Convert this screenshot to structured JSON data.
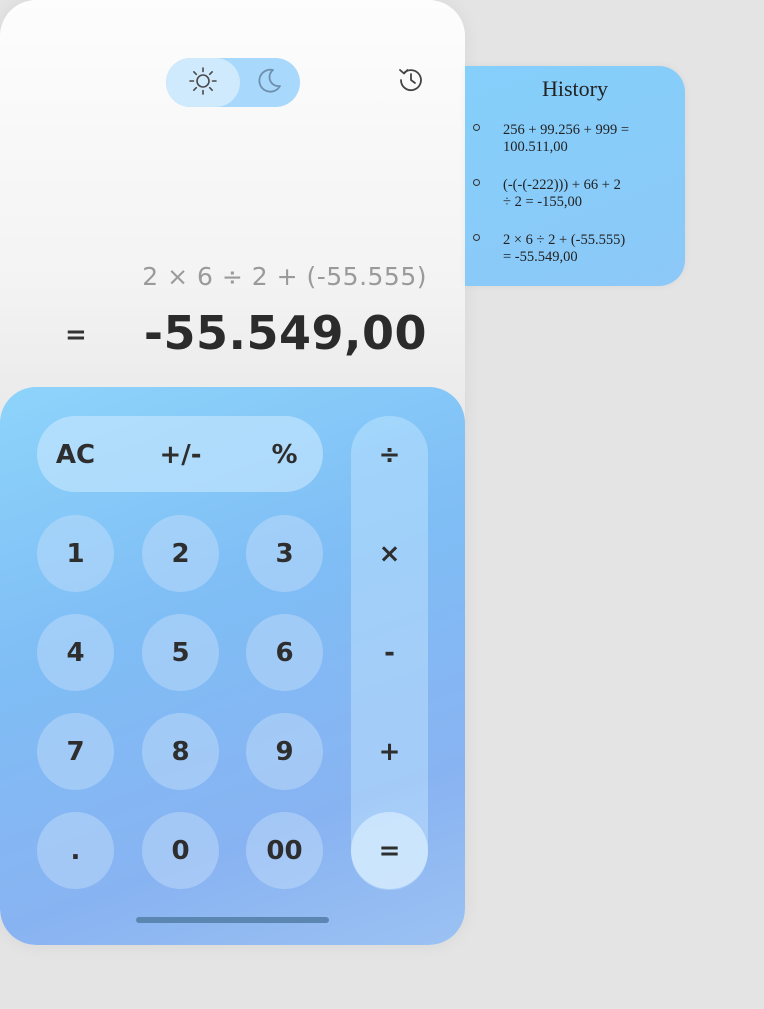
{
  "display": {
    "expression": "2 × 6 ÷ 2 + (-55.555)",
    "equals": "=",
    "result": "-55.549,00"
  },
  "toggle": {
    "light_icon": "sun-icon",
    "dark_icon": "moon-icon",
    "active": "light"
  },
  "history_icon": "history-clock-icon",
  "keys": {
    "ac": "AC",
    "sign": "+/-",
    "percent": "%",
    "divide": "÷",
    "multiply": "×",
    "subtract": "-",
    "add": "+",
    "equals": "=",
    "one": "1",
    "two": "2",
    "three": "3",
    "four": "4",
    "five": "5",
    "six": "6",
    "seven": "7",
    "eight": "8",
    "nine": "9",
    "dot": ".",
    "zero": "0",
    "double_zero": "00"
  },
  "history": {
    "title": "History",
    "items": [
      {
        "line1": "256 + 99.256 + 999 =",
        "line2": "100.511,00"
      },
      {
        "line1": "(-(-(-222))) + 66 + 2",
        "line2": "÷ 2 = -155,00"
      },
      {
        "line1": "2 × 6 ÷ 2 + (-55.555)",
        "line2": "= -55.549,00"
      }
    ]
  },
  "colors": {
    "keypad_top": "#8dd4fb",
    "keypad_bottom": "#88b3f2",
    "toggle_bg": "#a8d8fb",
    "history_bg": "#85cffb",
    "text_dark": "#2b2b2b",
    "expression_gray": "#9a9a9a"
  }
}
